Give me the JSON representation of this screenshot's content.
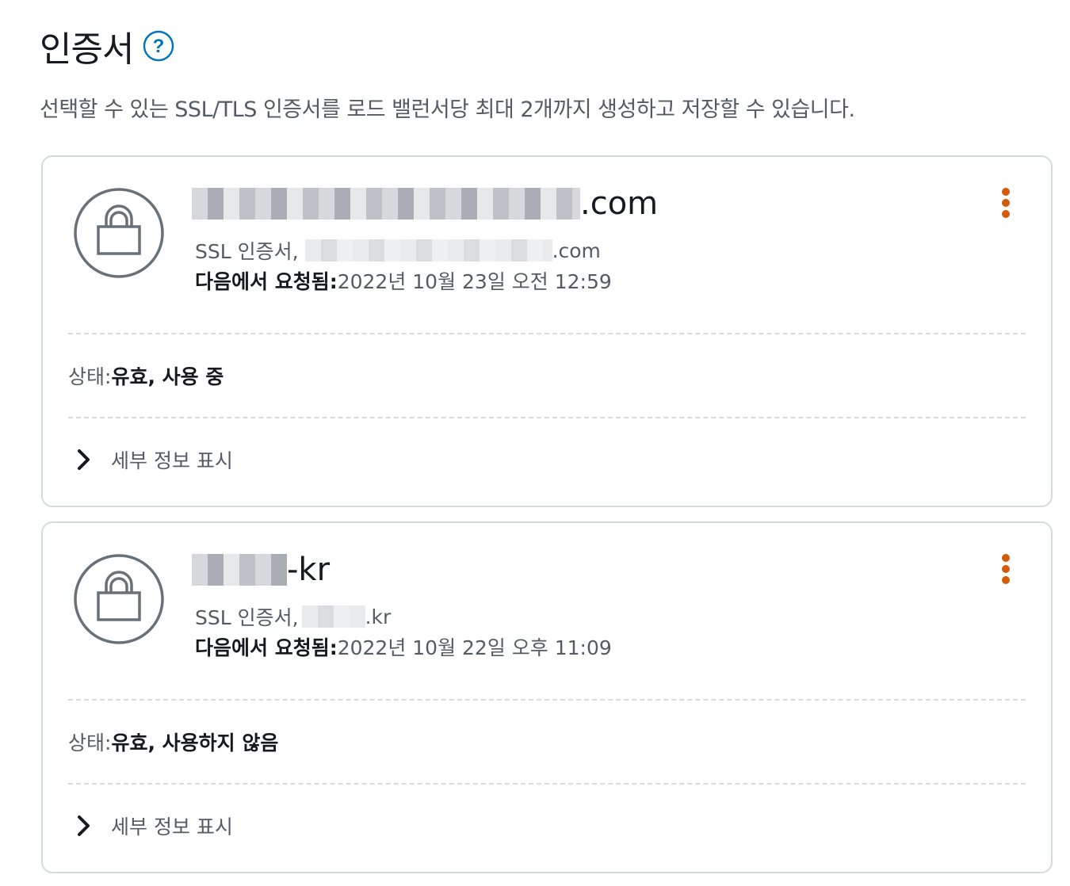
{
  "header": {
    "title": "인증서",
    "help_icon": "question-circle-icon"
  },
  "description": "선택할 수 있는 SSL/TLS 인증서를 로드 밸런서당 최대 2개까지 생성하고 저장할 수 있습니다.",
  "colors": {
    "accent_orange": "#d45b07",
    "help_blue": "#0073bb",
    "text_primary": "#16191f",
    "text_secondary": "#545b64",
    "border": "#d5dbdb",
    "lock_gray": "#687078"
  },
  "certificates": [
    {
      "name_suffix": ".com",
      "subtitle_prefix": "SSL 인증서,",
      "domain_suffix": ".com",
      "requested_label": "다음에서 요청됨:",
      "requested_value": "2022년 10월 23일 오전 12:59",
      "status_label": "상태:",
      "status_value": "유효, 사용 중",
      "details_label": "세부 정보 표시",
      "icon": "lock-icon",
      "menu_icon": "more-vertical-icon"
    },
    {
      "name_suffix": "-kr",
      "subtitle_prefix": "SSL 인증서,",
      "domain_suffix": ".kr",
      "requested_label": "다음에서 요청됨:",
      "requested_value": "2022년 10월 22일 오후 11:09",
      "status_label": "상태:",
      "status_value": "유효, 사용하지 않음",
      "details_label": "세부 정보 표시",
      "icon": "lock-icon",
      "menu_icon": "more-vertical-icon"
    }
  ]
}
